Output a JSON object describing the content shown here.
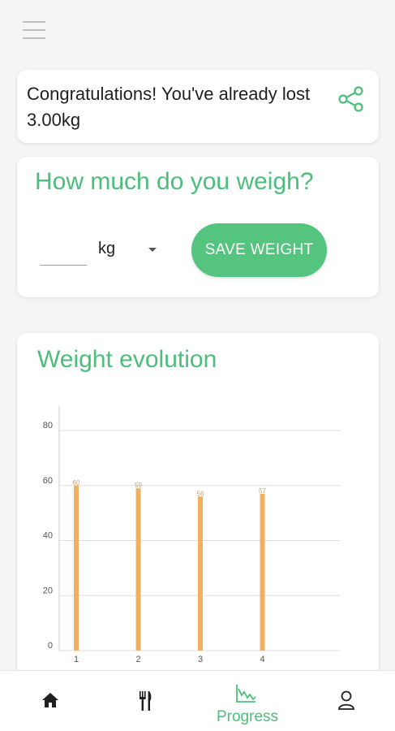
{
  "header": {
    "menu_icon": "hamburger-menu-icon"
  },
  "congrats": {
    "message": "Congratulations! You've already lost 3.00kg",
    "share_icon": "share-icon"
  },
  "weigh": {
    "title": "How much do you weigh?",
    "input_value": "",
    "unit": "kg",
    "save_label": "SAVE WEIGHT"
  },
  "evolution": {
    "title": "Weight evolution"
  },
  "chart_data": {
    "type": "bar",
    "categories": [
      "1",
      "2",
      "3",
      "4"
    ],
    "values": [
      60,
      59,
      56,
      57
    ],
    "data_labels": [
      "60",
      "59",
      "56",
      "57"
    ],
    "ylim": [
      0,
      80
    ],
    "yticks": [
      "0",
      "20",
      "40",
      "60",
      "80"
    ],
    "grid": true,
    "bar_color": "#f0b060"
  },
  "nav": {
    "items": [
      {
        "icon": "home-icon",
        "label": ""
      },
      {
        "icon": "fork-knife-icon",
        "label": ""
      },
      {
        "icon": "progress-chart-icon",
        "label": "Progress"
      },
      {
        "icon": "user-icon",
        "label": ""
      }
    ]
  },
  "colors": {
    "accent": "#4cbd7b",
    "bar": "#f0b060"
  }
}
